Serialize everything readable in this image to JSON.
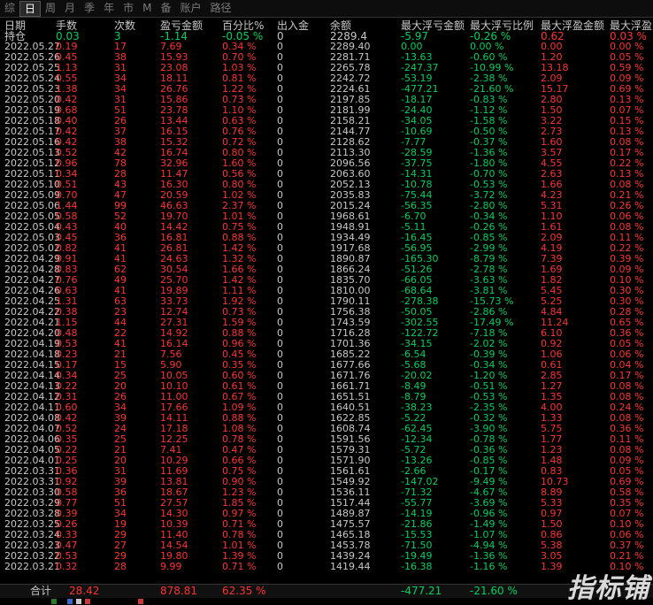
{
  "tabs": [
    "综",
    "日",
    "周",
    "月",
    "季",
    "年",
    "市",
    "M",
    "备",
    "账户",
    "路径"
  ],
  "active_tab": "日",
  "headers": [
    "日期",
    "手数",
    "次数",
    "盈亏金额",
    "百分比%",
    "出入金",
    "余额",
    "最大浮亏金额",
    "最大浮亏比例",
    "最大浮盈金额",
    "最大浮盈"
  ],
  "holding": {
    "label": "持仓",
    "lots": "0.03",
    "count": "3",
    "pnl": "-1.14",
    "pct": "-0.05 %",
    "io": "0",
    "bal": "2289.4",
    "mfl": "-5.97",
    "mflp": "-0.26 %",
    "mfp": "0.62",
    "mfpp": "0.03 %"
  },
  "rows": [
    {
      "d": "2022.05.27",
      "l": "0.19",
      "n": "17",
      "p": "7.69",
      "pc": "0.34 %",
      "io": "0",
      "b": "2289.40",
      "ml": "0.00",
      "mlp": "0.00 %",
      "mp": "0.00",
      "mpp": "0.00 %"
    },
    {
      "d": "2022.05.26",
      "l": "0.45",
      "n": "38",
      "p": "15.93",
      "pc": "0.70 %",
      "io": "0",
      "b": "2281.71",
      "ml": "-13.63",
      "mlp": "-0.60 %",
      "mp": "1.20",
      "mpp": "0.05 %"
    },
    {
      "d": "2022.05.25",
      "l": "1.13",
      "n": "31",
      "p": "23.08",
      "pc": "1.03 %",
      "io": "0",
      "b": "2265.78",
      "ml": "-247.37",
      "mlp": "-10.99 %",
      "mp": "13.18",
      "mpp": "0.59 %"
    },
    {
      "d": "2022.05.24",
      "l": "0.55",
      "n": "34",
      "p": "18.11",
      "pc": "0.81 %",
      "io": "0",
      "b": "2242.72",
      "ml": "-53.19",
      "mlp": "-2.38 %",
      "mp": "2.09",
      "mpp": "0.09 %"
    },
    {
      "d": "2022.05.23",
      "l": "1.38",
      "n": "34",
      "p": "26.76",
      "pc": "1.22 %",
      "io": "0",
      "b": "2224.61",
      "ml": "-477.21",
      "mlp": "-21.60 %",
      "mp": "15.17",
      "mpp": "0.69 %"
    },
    {
      "d": "2022.05.20",
      "l": "0.42",
      "n": "31",
      "p": "15.86",
      "pc": "0.73 %",
      "io": "0",
      "b": "2197.85",
      "ml": "-18.17",
      "mlp": "-0.83 %",
      "mp": "2.80",
      "mpp": "0.13 %"
    },
    {
      "d": "2022.05.19",
      "l": "0.68",
      "n": "51",
      "p": "23.78",
      "pc": "1.10 %",
      "io": "0",
      "b": "2181.99",
      "ml": "-24.40",
      "mlp": "-1.12 %",
      "mp": "1.50",
      "mpp": "0.07 %"
    },
    {
      "d": "2022.05.18",
      "l": "0.40",
      "n": "26",
      "p": "13.44",
      "pc": "0.63 %",
      "io": "0",
      "b": "2158.21",
      "ml": "-34.05",
      "mlp": "-1.58 %",
      "mp": "3.22",
      "mpp": "0.15 %"
    },
    {
      "d": "2022.05.17",
      "l": "0.42",
      "n": "37",
      "p": "16.15",
      "pc": "0.76 %",
      "io": "0",
      "b": "2144.77",
      "ml": "-10.69",
      "mlp": "-0.50 %",
      "mp": "2.73",
      "mpp": "0.13 %"
    },
    {
      "d": "2022.05.16",
      "l": "0.42",
      "n": "38",
      "p": "15.32",
      "pc": "0.72 %",
      "io": "0",
      "b": "2128.62",
      "ml": "-7.77",
      "mlp": "-0.37 %",
      "mp": "1.60",
      "mpp": "0.08 %"
    },
    {
      "d": "2022.05.13",
      "l": "0.52",
      "n": "42",
      "p": "16.74",
      "pc": "0.80 %",
      "io": "0",
      "b": "2113.30",
      "ml": "-28.59",
      "mlp": "-1.36 %",
      "mp": "3.57",
      "mpp": "0.17 %"
    },
    {
      "d": "2022.05.12",
      "l": "0.96",
      "n": "78",
      "p": "32.96",
      "pc": "1.60 %",
      "io": "0",
      "b": "2096.56",
      "ml": "-37.75",
      "mlp": "-1.80 %",
      "mp": "4.55",
      "mpp": "0.22 %"
    },
    {
      "d": "2022.05.11",
      "l": "0.34",
      "n": "28",
      "p": "11.47",
      "pc": "0.56 %",
      "io": "0",
      "b": "2063.60",
      "ml": "-14.31",
      "mlp": "-0.70 %",
      "mp": "2.63",
      "mpp": "0.13 %"
    },
    {
      "d": "2022.05.10",
      "l": "0.51",
      "n": "43",
      "p": "16.30",
      "pc": "0.80 %",
      "io": "0",
      "b": "2052.13",
      "ml": "-10.78",
      "mlp": "-0.53 %",
      "mp": "1.66",
      "mpp": "0.08 %"
    },
    {
      "d": "2022.05.09",
      "l": "0.70",
      "n": "47",
      "p": "20.59",
      "pc": "1.02 %",
      "io": "0",
      "b": "2035.83",
      "ml": "-75.44",
      "mlp": "-3.72 %",
      "mp": "4.23",
      "mpp": "0.21 %"
    },
    {
      "d": "2022.05.06",
      "l": "1.44",
      "n": "99",
      "p": "46.63",
      "pc": "2.37 %",
      "io": "0",
      "b": "2015.24",
      "ml": "-56.35",
      "mlp": "-2.80 %",
      "mp": "5.31",
      "mpp": "0.26 %"
    },
    {
      "d": "2022.05.05",
      "l": "0.58",
      "n": "52",
      "p": "19.70",
      "pc": "1.01 %",
      "io": "0",
      "b": "1968.61",
      "ml": "-6.70",
      "mlp": "-0.34 %",
      "mp": "1.10",
      "mpp": "0.06 %"
    },
    {
      "d": "2022.05.04",
      "l": "0.43",
      "n": "40",
      "p": "14.42",
      "pc": "0.75 %",
      "io": "0",
      "b": "1948.91",
      "ml": "-5.11",
      "mlp": "-0.26 %",
      "mp": "1.61",
      "mpp": "0.08 %"
    },
    {
      "d": "2022.05.03",
      "l": "0.45",
      "n": "36",
      "p": "16.81",
      "pc": "0.88 %",
      "io": "0",
      "b": "1934.49",
      "ml": "-16.45",
      "mlp": "-0.85 %",
      "mp": "2.09",
      "mpp": "0.11 %"
    },
    {
      "d": "2022.05.02",
      "l": "0.82",
      "n": "41",
      "p": "26.81",
      "pc": "1.42 %",
      "io": "0",
      "b": "1917.68",
      "ml": "-56.95",
      "mlp": "-2.99 %",
      "mp": "4.19",
      "mpp": "0.22 %"
    },
    {
      "d": "2022.04.29",
      "l": "0.91",
      "n": "41",
      "p": "24.63",
      "pc": "1.32 %",
      "io": "0",
      "b": "1890.87",
      "ml": "-165.30",
      "mlp": "-8.79 %",
      "mp": "7.39",
      "mpp": "0.39 %"
    },
    {
      "d": "2022.04.28",
      "l": "0.83",
      "n": "62",
      "p": "30.54",
      "pc": "1.66 %",
      "io": "0",
      "b": "1866.24",
      "ml": "-51.26",
      "mlp": "-2.78 %",
      "mp": "1.69",
      "mpp": "0.09 %"
    },
    {
      "d": "2022.04.27",
      "l": "0.76",
      "n": "49",
      "p": "25.70",
      "pc": "1.42 %",
      "io": "0",
      "b": "1835.70",
      "ml": "-66.05",
      "mlp": "-3.63 %",
      "mp": "1.82",
      "mpp": "0.10 %"
    },
    {
      "d": "2022.04.26",
      "l": "0.63",
      "n": "41",
      "p": "19.89",
      "pc": "1.11 %",
      "io": "0",
      "b": "1810.00",
      "ml": "-68.64",
      "mlp": "-3.81 %",
      "mp": "5.45",
      "mpp": "0.30 %"
    },
    {
      "d": "2022.04.25",
      "l": "1.31",
      "n": "63",
      "p": "33.73",
      "pc": "1.92 %",
      "io": "0",
      "b": "1790.11",
      "ml": "-278.38",
      "mlp": "-15.73 %",
      "mp": "5.25",
      "mpp": "0.30 %"
    },
    {
      "d": "2022.04.22",
      "l": "0.38",
      "n": "23",
      "p": "12.74",
      "pc": "0.73 %",
      "io": "0",
      "b": "1756.38",
      "ml": "-50.05",
      "mlp": "-2.86 %",
      "mp": "4.84",
      "mpp": "0.28 %"
    },
    {
      "d": "2022.04.21",
      "l": "1.15",
      "n": "44",
      "p": "27.31",
      "pc": "1.59 %",
      "io": "0",
      "b": "1743.59",
      "ml": "-302.55",
      "mlp": "-17.49 %",
      "mp": "11.24",
      "mpp": "0.65 %"
    },
    {
      "d": "2022.04.20",
      "l": "0.48",
      "n": "22",
      "p": "14.92",
      "pc": "0.88 %",
      "io": "0",
      "b": "1716.28",
      "ml": "-122.72",
      "mlp": "-7.18 %",
      "mp": "6.10",
      "mpp": "0.36 %"
    },
    {
      "d": "2022.04.19",
      "l": "0.53",
      "n": "41",
      "p": "16.14",
      "pc": "0.96 %",
      "io": "0",
      "b": "1701.36",
      "ml": "-34.15",
      "mlp": "-2.02 %",
      "mp": "0.92",
      "mpp": "0.05 %"
    },
    {
      "d": "2022.04.18",
      "l": "0.23",
      "n": "21",
      "p": "7.56",
      "pc": "0.45 %",
      "io": "0",
      "b": "1685.22",
      "ml": "-6.54",
      "mlp": "-0.39 %",
      "mp": "1.06",
      "mpp": "0.06 %"
    },
    {
      "d": "2022.04.15",
      "l": "0.17",
      "n": "15",
      "p": "5.90",
      "pc": "0.35 %",
      "io": "0",
      "b": "1677.66",
      "ml": "-5.68",
      "mlp": "-0.34 %",
      "mp": "0.61",
      "mpp": "0.04 %"
    },
    {
      "d": "2022.04.14",
      "l": "0.34",
      "n": "25",
      "p": "10.05",
      "pc": "0.60 %",
      "io": "0",
      "b": "1671.76",
      "ml": "-20.02",
      "mlp": "-1.20 %",
      "mp": "2.85",
      "mpp": "0.17 %"
    },
    {
      "d": "2022.04.13",
      "l": "0.22",
      "n": "20",
      "p": "10.10",
      "pc": "0.61 %",
      "io": "0",
      "b": "1661.71",
      "ml": "-8.49",
      "mlp": "-0.51 %",
      "mp": "1.27",
      "mpp": "0.08 %"
    },
    {
      "d": "2022.04.12",
      "l": "0.31",
      "n": "26",
      "p": "11.00",
      "pc": "0.67 %",
      "io": "0",
      "b": "1651.51",
      "ml": "-8.79",
      "mlp": "-0.53 %",
      "mp": "1.35",
      "mpp": "0.08 %"
    },
    {
      "d": "2022.04.11",
      "l": "0.60",
      "n": "34",
      "p": "17.66",
      "pc": "1.09 %",
      "io": "0",
      "b": "1640.51",
      "ml": "-38.23",
      "mlp": "-2.35 %",
      "mp": "4.00",
      "mpp": "0.24 %"
    },
    {
      "d": "2022.04.08",
      "l": "0.42",
      "n": "39",
      "p": "14.11",
      "pc": "0.88 %",
      "io": "0",
      "b": "1622.85",
      "ml": "-5.22",
      "mlp": "-0.32 %",
      "mp": "1.33",
      "mpp": "0.08 %"
    },
    {
      "d": "2022.04.07",
      "l": "0.52",
      "n": "24",
      "p": "17.18",
      "pc": "1.08 %",
      "io": "0",
      "b": "1608.74",
      "ml": "-62.45",
      "mlp": "-3.90 %",
      "mp": "5.75",
      "mpp": "0.36 %"
    },
    {
      "d": "2022.04.06",
      "l": "0.35",
      "n": "25",
      "p": "12.25",
      "pc": "0.78 %",
      "io": "0",
      "b": "1591.56",
      "ml": "-12.34",
      "mlp": "-0.78 %",
      "mp": "1.77",
      "mpp": "0.11 %"
    },
    {
      "d": "2022.04.05",
      "l": "0.22",
      "n": "21",
      "p": "7.41",
      "pc": "0.47 %",
      "io": "0",
      "b": "1579.31",
      "ml": "-5.72",
      "mlp": "-0.36 %",
      "mp": "1.23",
      "mpp": "0.08 %"
    },
    {
      "d": "2022.04.01",
      "l": "0.25",
      "n": "20",
      "p": "10.29",
      "pc": "0.66 %",
      "io": "0",
      "b": "1571.90",
      "ml": "-13.26",
      "mlp": "-0.85 %",
      "mp": "1.48",
      "mpp": "0.09 %"
    },
    {
      "d": "2022.03.31",
      "l": "0.36",
      "n": "31",
      "p": "11.69",
      "pc": "0.75 %",
      "io": "0",
      "b": "1561.61",
      "ml": "-2.66",
      "mlp": "-0.17 %",
      "mp": "0.83",
      "mpp": "0.05 %"
    },
    {
      "d": "2022.03.31",
      "l": "0.92",
      "n": "39",
      "p": "13.81",
      "pc": "0.90 %",
      "io": "0",
      "b": "1549.92",
      "ml": "-147.02",
      "mlp": "-9.49 %",
      "mp": "10.73",
      "mpp": "0.69 %"
    },
    {
      "d": "2022.03.30",
      "l": "0.58",
      "n": "36",
      "p": "18.67",
      "pc": "1.23 %",
      "io": "0",
      "b": "1536.11",
      "ml": "-71.32",
      "mlp": "-4.67 %",
      "mp": "8.89",
      "mpp": "0.58 %"
    },
    {
      "d": "2022.03.29",
      "l": "0.77",
      "n": "51",
      "p": "27.57",
      "pc": "1.85 %",
      "io": "0",
      "b": "1517.44",
      "ml": "-55.77",
      "mlp": "-3.69 %",
      "mp": "5.33",
      "mpp": "0.35 %"
    },
    {
      "d": "2022.03.28",
      "l": "0.39",
      "n": "34",
      "p": "14.30",
      "pc": "0.97 %",
      "io": "0",
      "b": "1489.87",
      "ml": "-14.19",
      "mlp": "-0.96 %",
      "mp": "0.97",
      "mpp": "0.07 %"
    },
    {
      "d": "2022.03.25",
      "l": "0.26",
      "n": "19",
      "p": "10.39",
      "pc": "0.71 %",
      "io": "0",
      "b": "1475.57",
      "ml": "-21.86",
      "mlp": "-1.49 %",
      "mp": "1.50",
      "mpp": "0.10 %"
    },
    {
      "d": "2022.03.24",
      "l": "0.33",
      "n": "29",
      "p": "11.40",
      "pc": "0.78 %",
      "io": "0",
      "b": "1465.18",
      "ml": "-15.53",
      "mlp": "-1.07 %",
      "mp": "0.86",
      "mpp": "0.06 %"
    },
    {
      "d": "2022.03.23",
      "l": "0.47",
      "n": "27",
      "p": "14.54",
      "pc": "1.01 %",
      "io": "0",
      "b": "1453.78",
      "ml": "-71.50",
      "mlp": "-4.94 %",
      "mp": "5.38",
      "mpp": "0.37 %"
    },
    {
      "d": "2022.03.22",
      "l": "0.53",
      "n": "29",
      "p": "19.80",
      "pc": "1.39 %",
      "io": "0",
      "b": "1439.24",
      "ml": "-19.49",
      "mlp": "-1.36 %",
      "mp": "3.05",
      "mpp": "0.21 %"
    },
    {
      "d": "2022.03.21",
      "l": "0.32",
      "n": "28",
      "p": "9.99",
      "pc": "0.71 %",
      "io": "0",
      "b": "1419.44",
      "ml": "-16.38",
      "mlp": "-1.16 %",
      "mp": "1.39",
      "mpp": "0.10 %"
    }
  ],
  "total": {
    "label": "合计",
    "lots": "28.42",
    "pnl": "878.81",
    "pct": "62.35 %",
    "mfl": "-477.21",
    "mflp": "-21.60 %"
  },
  "watermark": "指标铺",
  "colors": {
    "red": "#ff3232",
    "green": "#00d060",
    "text": "#c8c8c8",
    "bg": "#000000"
  }
}
